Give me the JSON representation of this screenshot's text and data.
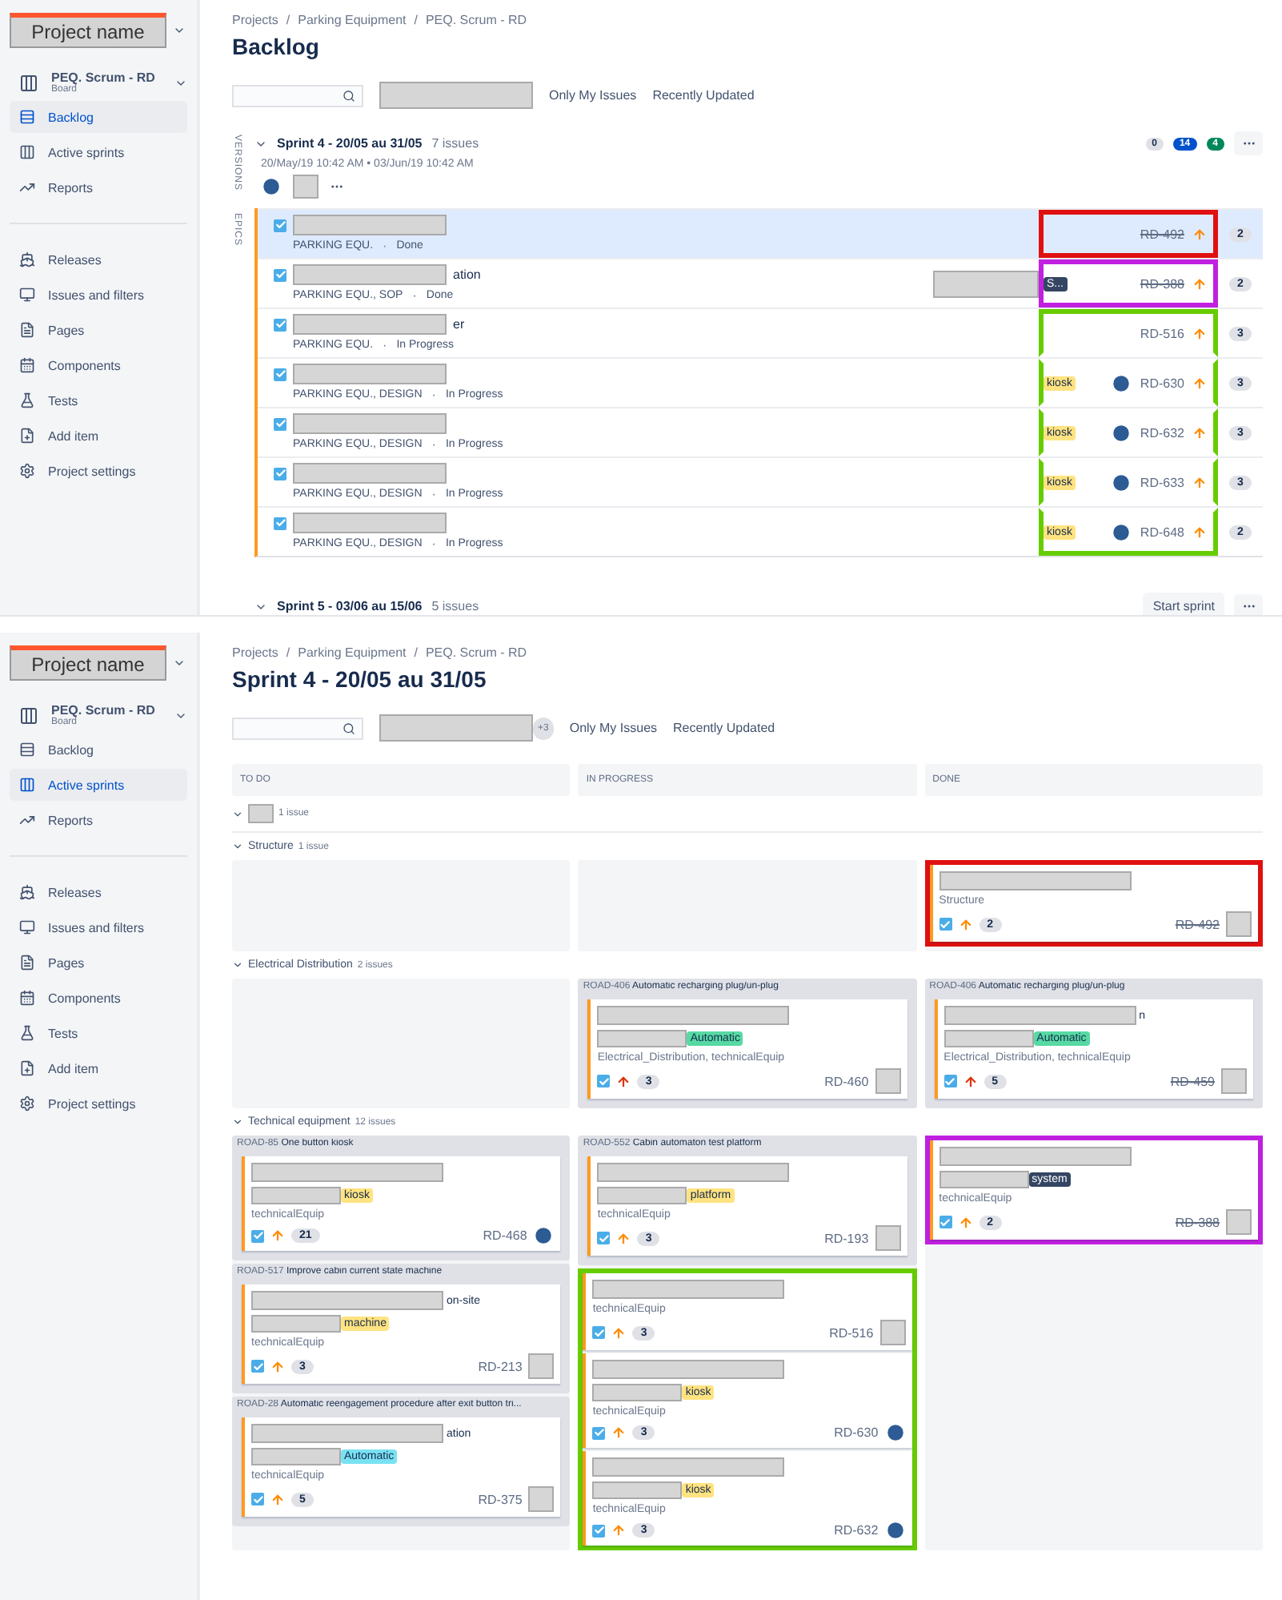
{
  "backlog_screen": {
    "sidebar": {
      "project_name": "Project name",
      "board": {
        "name": "PEQ. Scrum - RD",
        "type": "Board"
      },
      "items": [
        {
          "label": "Backlog",
          "selected": true
        },
        {
          "label": "Active sprints",
          "selected": false
        },
        {
          "label": "Reports",
          "selected": false
        }
      ],
      "links": [
        "Releases",
        "Issues and filters",
        "Pages",
        "Components",
        "Tests",
        "Add item",
        "Project settings"
      ]
    },
    "breadcrumbs": [
      "Projects",
      "Parking Equipment",
      "PEQ. Scrum - RD"
    ],
    "breadcrumb_separator": "/",
    "title": "Backlog",
    "filters": [
      "Only My Issues",
      "Recently Updated"
    ],
    "side_tabs": [
      "VERSIONS",
      "EPICS"
    ],
    "sprint": {
      "name": "Sprint 4 - 20/05 au 31/05",
      "count": "7 issues",
      "dates": "20/May/19 10:42 AM • 03/Jun/19 10:42 AM",
      "status_counts": [
        {
          "value": "0",
          "color": "#dfe1e6"
        },
        {
          "value": "14",
          "color": "#0052cc"
        },
        {
          "value": "4",
          "color": "#00875a"
        }
      ],
      "meta_separator": "·",
      "issues": [
        {
          "redacted": true,
          "epic": "PARKING EQU.",
          "status": "Done",
          "key": "RD-492",
          "done": true,
          "points": "2",
          "selected": true,
          "checked": true,
          "color": "#e01010"
        },
        {
          "title": "ation",
          "redacted": true,
          "epic": "PARKING EQU., SOP",
          "status": "Done",
          "label": {
            "text": "S...",
            "color": "#344563"
          },
          "key": "RD-388",
          "done": true,
          "points": "2",
          "selected": false,
          "checked": true,
          "color": "#c020e0"
        },
        {
          "title": "er",
          "redacted": true,
          "epic": "PARKING EQU.",
          "status": "In Progress",
          "key": "RD-516",
          "done": false,
          "points": "3",
          "selected": false,
          "checked": true,
          "color": "#66cc00"
        },
        {
          "redacted": true,
          "epic": "PARKING EQU., DESIGN",
          "status": "In Progress",
          "label": {
            "text": "kiosk",
            "color": "#ffe380"
          },
          "avatar": true,
          "key": "RD-630",
          "done": false,
          "points": "3",
          "selected": false,
          "checked": true,
          "color": "#66cc00"
        },
        {
          "redacted": true,
          "epic": "PARKING EQU., DESIGN",
          "status": "In Progress",
          "label": {
            "text": "kiosk",
            "color": "#ffe380"
          },
          "avatar": true,
          "key": "RD-632",
          "done": false,
          "points": "3",
          "selected": false,
          "checked": true,
          "color": "#66cc00"
        },
        {
          "redacted": true,
          "epic": "PARKING EQU., DESIGN",
          "status": "In Progress",
          "label": {
            "text": "kiosk",
            "color": "#ffe380"
          },
          "avatar": true,
          "key": "RD-633",
          "done": false,
          "points": "3",
          "selected": false,
          "checked": true,
          "color": "#66cc00"
        },
        {
          "redacted": true,
          "epic": "PARKING EQU., DESIGN",
          "status": "In Progress",
          "label": {
            "text": "kiosk",
            "color": "#ffe380"
          },
          "avatar": true,
          "key": "RD-648",
          "done": false,
          "points": "2",
          "selected": false,
          "checked": true,
          "color": "#66cc00"
        }
      ]
    },
    "next_sprint": {
      "name": "Sprint 5 - 03/06 au 15/06",
      "count": "5 issues",
      "button": "Start sprint"
    }
  },
  "board_screen": {
    "sidebar": {
      "project_name": "Project name",
      "board": {
        "name": "PEQ. Scrum - RD",
        "type": "Board"
      },
      "items": [
        {
          "label": "Backlog",
          "selected": false
        },
        {
          "label": "Active sprints",
          "selected": true
        },
        {
          "label": "Reports",
          "selected": false
        }
      ],
      "links": [
        "Releases",
        "Issues and filters",
        "Pages",
        "Components",
        "Tests",
        "Add item",
        "Project settings"
      ]
    },
    "breadcrumbs": [
      "Projects",
      "Parking Equipment",
      "PEQ. Scrum - RD"
    ],
    "breadcrumb_separator": "/",
    "title": "Sprint 4 - 20/05 au 31/05",
    "more_people": "+3",
    "filters": [
      "Only My Issues",
      "Recently Updated"
    ],
    "columns": [
      "TO DO",
      "IN PROGRESS",
      "DONE"
    ],
    "swimlanes": [
      {
        "redacted": true,
        "count": "1 issue",
        "cells": [
          [],
          [],
          []
        ]
      },
      {
        "name": "Structure",
        "count": "1 issue",
        "cells": [
          [],
          [],
          [
            {
              "cards": [
                {
                  "components": "Structure",
                  "checked": true,
                  "highest": false,
                  "points": "2",
                  "key": "RD-492",
                  "done": true,
                  "color": "#e01010"
                }
              ]
            }
          ]
        ]
      },
      {
        "name": "Electrical Distribution",
        "count": "2 issues",
        "cells": [
          [],
          [
            {
              "parent_key": "ROAD-406",
              "parent_title": "Automatic recharging plug/un-plug",
              "cards": [
                {
                  "label": {
                    "text": "Automatic",
                    "color": "#57d9a3"
                  },
                  "components": "Electrical_Distribution, technicalEquip",
                  "checked": true,
                  "highest": true,
                  "points": "3",
                  "key": "RD-460",
                  "done": false
                }
              ]
            }
          ],
          [
            {
              "parent_key": "ROAD-406",
              "parent_title": "Automatic recharging plug/un-plug",
              "cards": [
                {
                  "title": "n",
                  "label": {
                    "text": "Automatic",
                    "color": "#57d9a3"
                  },
                  "components": "Electrical_Distribution, technicalEquip",
                  "checked": true,
                  "highest": true,
                  "points": "5",
                  "key": "RD-459",
                  "done": true
                }
              ]
            }
          ]
        ]
      },
      {
        "name": "Technical equipment",
        "count": "12 issues",
        "cells": [
          [
            {
              "parent_key": "ROAD-85",
              "parent_title": "One button kiosk",
              "cards": [
                {
                  "label": {
                    "text": "kiosk",
                    "color": "#ffe380"
                  },
                  "components": "technicalEquip",
                  "checked": true,
                  "highest": false,
                  "points": "21",
                  "key": "RD-468",
                  "done": false,
                  "avatar": true
                }
              ]
            },
            {
              "parent_key": "ROAD-517",
              "parent_title": "Improve cabin current state machine",
              "cards": [
                {
                  "title": "on-site",
                  "label": {
                    "text": "machine",
                    "color": "#ffe380"
                  },
                  "components": "technicalEquip",
                  "checked": true,
                  "highest": false,
                  "points": "3",
                  "key": "RD-213",
                  "done": false
                }
              ]
            },
            {
              "parent_key": "ROAD-28",
              "parent_title": "Automatic reengagement procedure after exit button tri...",
              "cards": [
                {
                  "title": "ation",
                  "label": {
                    "text": "Automatic",
                    "color": "#79e2f2"
                  },
                  "components": "technicalEquip",
                  "checked": true,
                  "highest": false,
                  "points": "5",
                  "key": "RD-375",
                  "done": false
                }
              ]
            }
          ],
          [
            {
              "parent_key": "ROAD-552",
              "parent_title": "Cabin automaton test platform",
              "cards": [
                {
                  "label": {
                    "text": "platform",
                    "color": "#ffe380"
                  },
                  "components": "technicalEquip",
                  "checked": true,
                  "highest": false,
                  "points": "3",
                  "key": "RD-193",
                  "done": false
                }
              ]
            },
            {
              "cards": [
                {
                  "components": "technicalEquip",
                  "checked": true,
                  "highest": false,
                  "points": "3",
                  "key": "RD-516",
                  "done": false,
                  "color": "#66cc00"
                },
                {
                  "label": {
                    "text": "kiosk",
                    "color": "#ffe380"
                  },
                  "components": "technicalEquip",
                  "checked": true,
                  "highest": false,
                  "points": "3",
                  "key": "RD-630",
                  "done": false,
                  "avatar": true,
                  "color": "#66cc00"
                },
                {
                  "label": {
                    "text": "kiosk",
                    "color": "#ffe380"
                  },
                  "components": "technicalEquip",
                  "checked": true,
                  "highest": false,
                  "points": "3",
                  "key": "RD-632",
                  "done": false,
                  "avatar": true,
                  "color": "#66cc00"
                }
              ]
            }
          ],
          [
            {
              "cards": [
                {
                  "label": {
                    "text": "system",
                    "color": "#344563"
                  },
                  "components": "technicalEquip",
                  "checked": true,
                  "highest": false,
                  "points": "2",
                  "key": "RD-388",
                  "done": true,
                  "color": "#c020e0"
                }
              ]
            }
          ]
        ]
      }
    ]
  }
}
